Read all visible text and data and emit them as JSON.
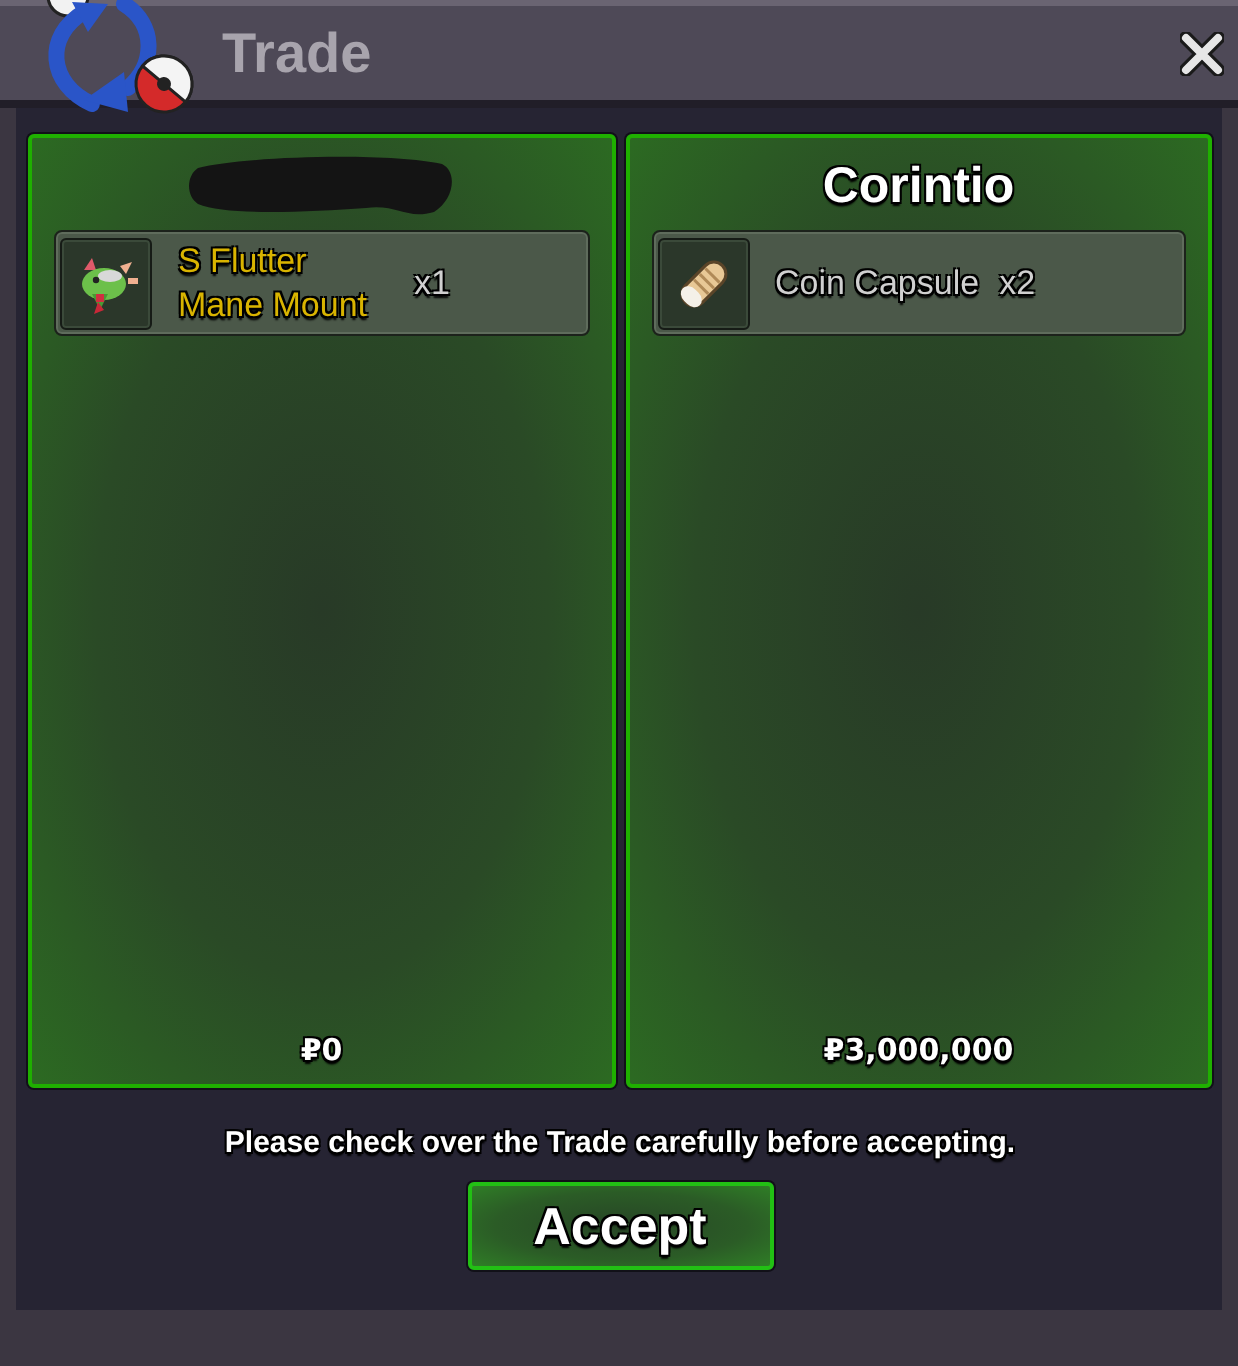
{
  "window": {
    "title": "Trade"
  },
  "offers": [
    {
      "redacted": true,
      "items": [
        {
          "kind": "mount",
          "name": "S Flutter Mane Mount",
          "quantity": "x1",
          "color": "#d9b400"
        }
      ],
      "money": "₽0"
    },
    {
      "redacted": false,
      "trader": "Corintio",
      "items": [
        {
          "kind": "capsule",
          "name": "Coin Capsule",
          "quantity": "x2",
          "color": "#d0d0d0"
        }
      ],
      "money": "₽3,000,000"
    }
  ],
  "notice": "Please check over the Trade carefully before accepting.",
  "accept_button": "Accept"
}
